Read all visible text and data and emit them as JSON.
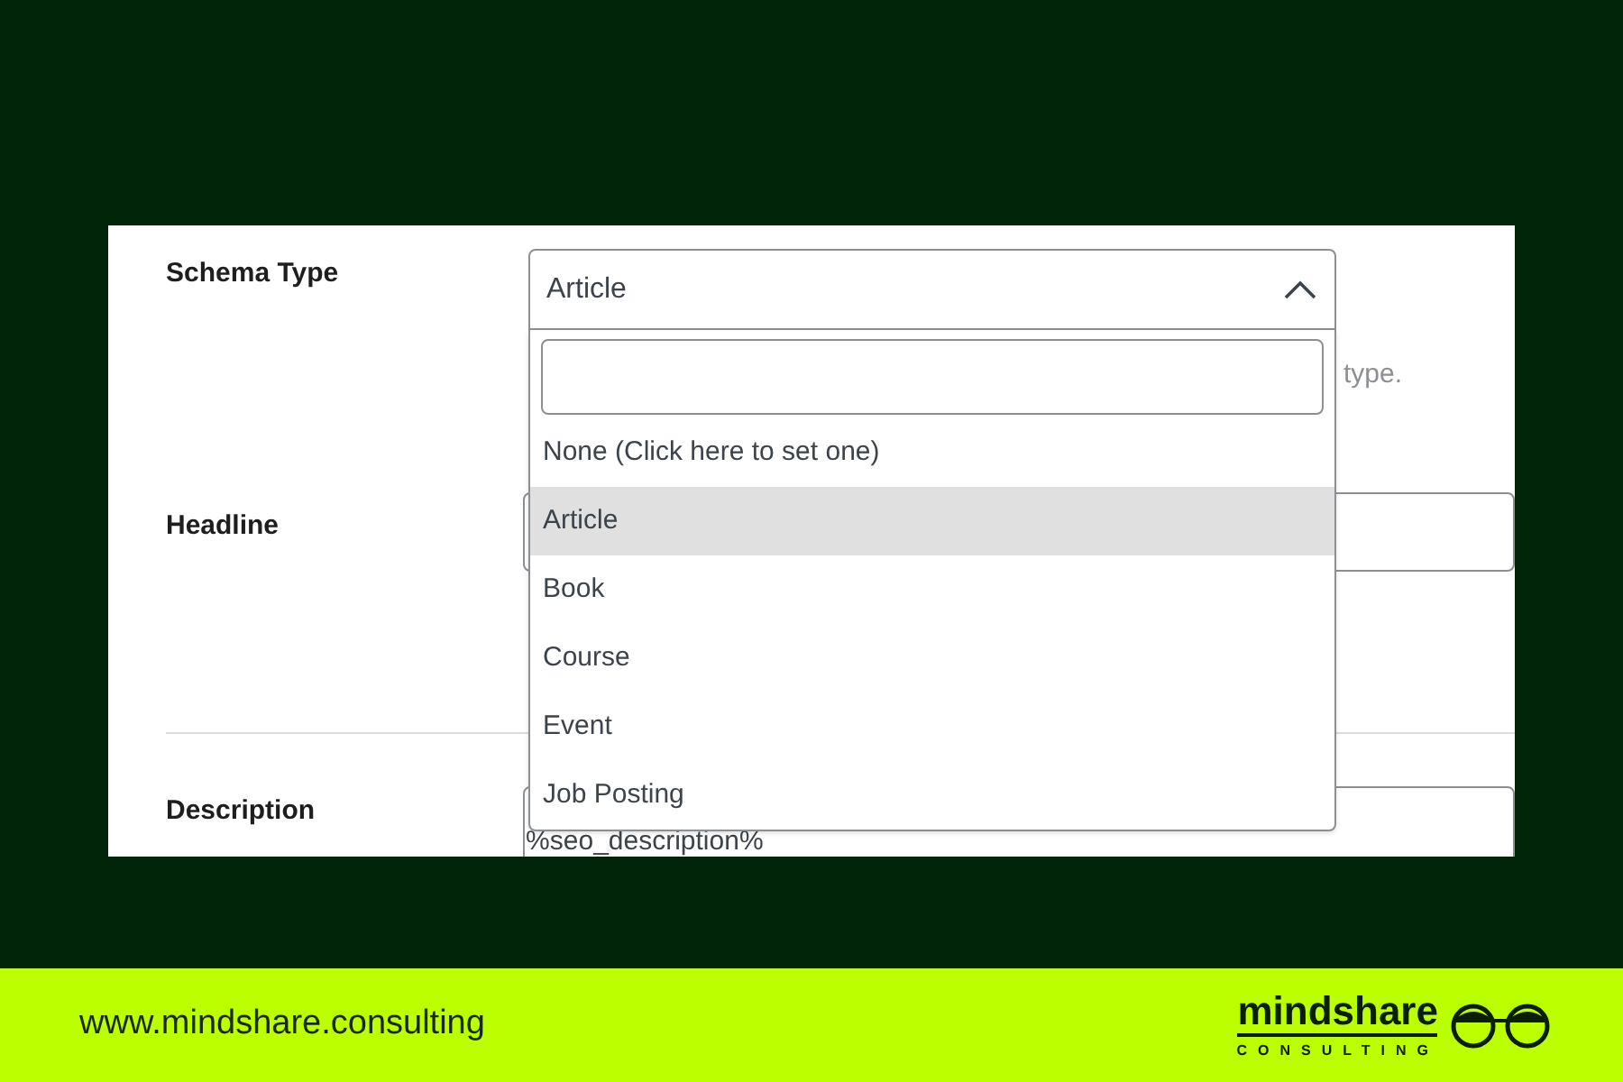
{
  "schema_type": {
    "label": "Schema Type",
    "value": "Article",
    "expanded": true,
    "help_text": "type.",
    "options": [
      {
        "label": "None (Click here to set one)",
        "selected": false
      },
      {
        "label": "Article",
        "selected": true
      },
      {
        "label": "Book",
        "selected": false
      },
      {
        "label": "Course",
        "selected": false
      },
      {
        "label": "Event",
        "selected": false
      },
      {
        "label": "Job Posting",
        "selected": false
      }
    ]
  },
  "headline": {
    "label": "Headline"
  },
  "description": {
    "label": "Description",
    "value": "%seo_description%"
  },
  "footer": {
    "url": "www.mindshare.consulting",
    "logo_text": "mindshare",
    "logo_subtext": "CONSULTING"
  }
}
